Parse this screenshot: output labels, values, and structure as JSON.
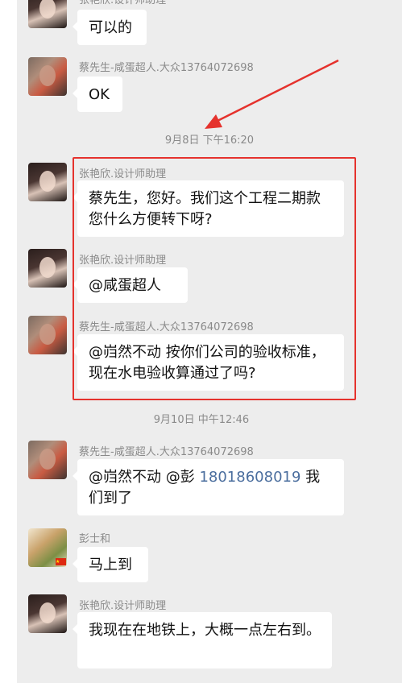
{
  "messages": [
    {
      "sender": "张艳欣.设计师助理",
      "avatar": "girl-avatar",
      "text": "可以的"
    },
    {
      "sender": "蔡先生-咸蛋超人.大众13764072698",
      "avatar": "man-avatar",
      "text": "OK"
    },
    {
      "sender": "张艳欣.设计师助理",
      "avatar": "girl-avatar",
      "text": "蔡先生，您好。我们这个工程二期款您什么方便转下呀?"
    },
    {
      "sender": "张艳欣.设计师助理",
      "avatar": "girl-avatar",
      "text": "@咸蛋超人"
    },
    {
      "sender": "蔡先生-咸蛋超人.大众13764072698",
      "avatar": "man-avatar",
      "text": "@岿然不动  按你们公司的验收标准，现在水电验收算通过了吗?"
    },
    {
      "sender": "蔡先生-咸蛋超人.大众13764072698",
      "avatar": "man-avatar",
      "text_prefix": "@岿然不动 @彭 ",
      "phone": "18018608019",
      "text_suffix": " 我们到了"
    },
    {
      "sender": "彭士和",
      "avatar": "tea-avatar",
      "text": "马上到"
    },
    {
      "sender": "张艳欣.设计师助理",
      "avatar": "girl-avatar",
      "text": "我现在在地铁上，大概一点左右到。"
    }
  ],
  "timestamps": [
    "9月8日 下午16:20",
    "9月10日 中午12:46"
  ],
  "colors": {
    "chat_background": "#ededed",
    "bubble": "#ffffff",
    "annotation_red": "#e5322d",
    "phone_link": "#4b6e9e"
  }
}
